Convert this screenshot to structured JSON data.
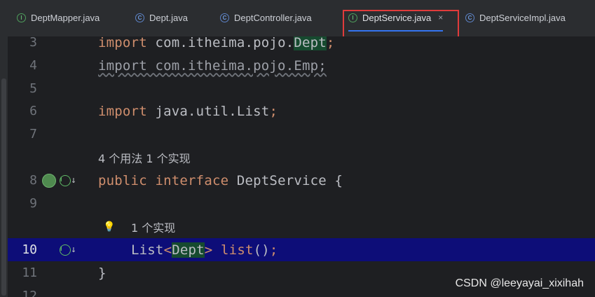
{
  "tabs": [
    {
      "label": "DeptMapper.java",
      "icon": "interface-icon"
    },
    {
      "label": "Dept.java",
      "icon": "class-icon"
    },
    {
      "label": "DeptController.java",
      "icon": "class-icon"
    },
    {
      "label": "DeptService.java",
      "icon": "interface-icon",
      "active": true,
      "close": "×"
    },
    {
      "label": "DeptServiceImpl.java",
      "icon": "class-icon"
    }
  ],
  "editor": {
    "lines": [
      {
        "num": "3",
        "import_kw": "import",
        "pkg": " com.itheima.pojo.",
        "cls": "Dept",
        "semi": ";"
      },
      {
        "num": "4",
        "text": "import com.itheima.pojo.Emp;"
      },
      {
        "num": "5"
      },
      {
        "num": "6",
        "import_kw": "import",
        "pkg": " java.util.List",
        "semi": ";"
      },
      {
        "num": "7"
      },
      {
        "inlay": "4 个用法   1 个实现"
      },
      {
        "num": "8",
        "kw1": "public",
        "kw2": " interface",
        "name": " DeptService {"
      },
      {
        "num": "9"
      },
      {
        "inlay": "1 个实现"
      },
      {
        "num": "10",
        "type": "List",
        "lt": "<",
        "generic": "Dept",
        "gt": ">",
        "method": " list",
        "parens": "()",
        "semi": ";"
      },
      {
        "num": "11",
        "brace": "}"
      },
      {
        "num": "12"
      }
    ]
  },
  "watermark": "CSDN @leeyayai_xixihah"
}
